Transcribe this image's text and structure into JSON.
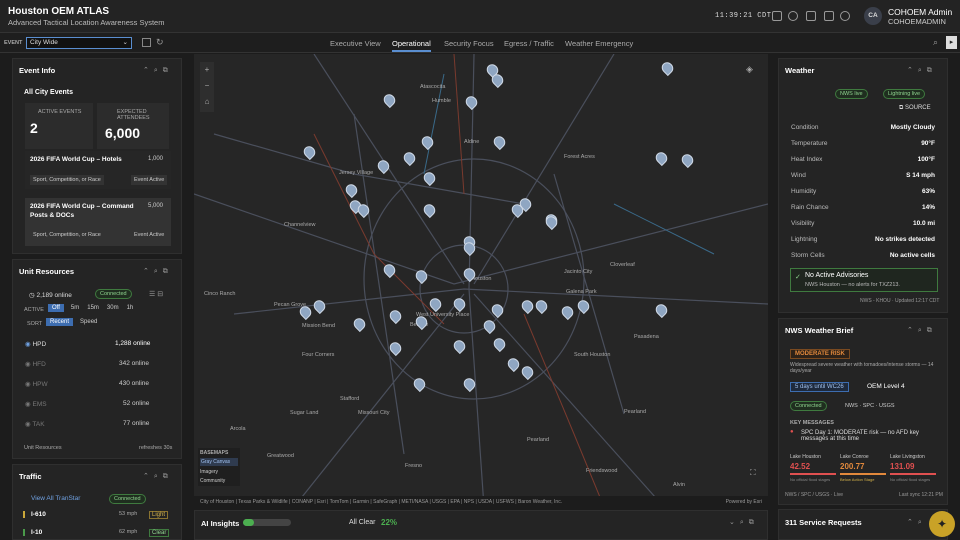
{
  "app": {
    "title": "Houston OEM ATLAS",
    "subtitle": "Advanced Tactical Location Awareness System",
    "clock": "11:39:21 CDT",
    "user_initials": "CA",
    "user_name": "COHOEM Admin",
    "user_id": "COHOEMADMIN"
  },
  "event": {
    "label": "EVENT",
    "selected": "City Wide"
  },
  "tabs": [
    "Executive View",
    "Operational",
    "Security Focus",
    "Egress / Traffic",
    "Weather Emergency"
  ],
  "event_info": {
    "title": "Event Info",
    "all_label": "All City Events",
    "active_label": "ACTIVE EVENTS",
    "active_value": "2",
    "expected_label": "EXPECTED ATTENDEES",
    "expected_value": "6,000",
    "events": [
      {
        "name": "2026 FIFA World Cup – Hotels",
        "count": "1,000",
        "tag1": "Sport, Competition, or Race",
        "tag2": "Event Active"
      },
      {
        "name": "2026 FIFA World Cup – Command Posts & DOCs",
        "count": "5,000",
        "tag1": "Sport, Competition, or Race",
        "tag2": "Event Active"
      }
    ]
  },
  "units": {
    "title": "Unit Resources",
    "online": "2,189 online",
    "connected": "Connected",
    "active_label": "ACTIVE",
    "windows": [
      "Off",
      "5m",
      "15m",
      "30m",
      "1h"
    ],
    "sort_label": "SORT",
    "sorts": [
      "Recent",
      "Speed"
    ],
    "rows": [
      {
        "name": "HPD",
        "value": "1,288 online"
      },
      {
        "name": "HFD",
        "value": "342 online"
      },
      {
        "name": "HPW",
        "value": "430 online"
      },
      {
        "name": "EMS",
        "value": "52 online"
      },
      {
        "name": "TAK",
        "value": "77 online"
      }
    ],
    "footer_left": "Unit Resources",
    "footer_right": "refreshes 30s"
  },
  "traffic": {
    "title": "Traffic",
    "link": "View All TranStar",
    "connected": "Connected",
    "rows": [
      {
        "name": "I-610",
        "speed": "53 mph",
        "status": "Light"
      },
      {
        "name": "I-10",
        "speed": "62 mph",
        "status": "Clear"
      }
    ]
  },
  "map": {
    "labels": [
      "Atascocita",
      "Humble",
      "Jersey Village",
      "Aldine",
      "Forest Acres",
      "Cloverleaf",
      "Jacinto City",
      "Galena Park",
      "Pasadena",
      "South Houston",
      "Houston",
      "West University Place",
      "Bellaire",
      "Mission Bend",
      "Four Corners",
      "Cinco Ranch",
      "Sugar Land",
      "Stafford",
      "Missouri City",
      "Pearland",
      "Friendswood",
      "Fresno",
      "Greatwood",
      "Arcola",
      "Alvin",
      "Pecan Grove",
      "Pearland",
      "Channelview"
    ],
    "basemaps_title": "BASEMAPS",
    "basemaps": [
      "Gray Canvas",
      "Imagery",
      "Community"
    ],
    "attribution": "City of Houston | Texas Parks & Wildlife | CONANP | Esri | TomTom | Garmin | SafeGraph | METI/NASA | USGS | EPA | NPS | USDA | USFWS | Baron Weather, Inc.",
    "powered": "Powered by Esri"
  },
  "ai": {
    "title": "AI Insights",
    "status": "All Clear",
    "percent": "22%"
  },
  "weather": {
    "title": "Weather",
    "nws": "NWS live",
    "lightning": "Lightning live",
    "source": "SOURCE",
    "rows": [
      {
        "k": "Condition",
        "v": "Mostly Cloudy"
      },
      {
        "k": "Temperature",
        "v": "90°F"
      },
      {
        "k": "Heat Index",
        "v": "100°F"
      },
      {
        "k": "Wind",
        "v": "S 14 mph"
      },
      {
        "k": "Humidity",
        "v": "63%"
      },
      {
        "k": "Rain Chance",
        "v": "14%"
      },
      {
        "k": "Visibility",
        "v": "10.0 mi"
      },
      {
        "k": "Lightning",
        "v": "No strikes detected"
      },
      {
        "k": "Storm Cells",
        "v": "No active cells"
      }
    ],
    "advisory_title": "No Active Advisories",
    "advisory_sub": "NWS Houston — no alerts for TXZ213.",
    "footer": "NWS - KHOU · Updated 12:17 CDT"
  },
  "brief": {
    "title": "NWS Weather Brief",
    "risk": "MODERATE RISK",
    "risk_text": "Widespread severe weather with tornadoes/intense storms — 14 days/year",
    "countdown": "5 days until WC26",
    "oem": "OEM Level 4",
    "connected": "Connected",
    "sources": [
      "NWS",
      "SPC",
      "USGS"
    ],
    "key_title": "KEY MESSAGES",
    "key_text": "SPC Day 1: MODERATE risk — no AFD key messages at this time",
    "lakes": [
      {
        "name": "Lake Houston",
        "value": "42.52",
        "note": "No official flood stages"
      },
      {
        "name": "Lake Conroe",
        "value": "200.77",
        "note": "Below Action Stage"
      },
      {
        "name": "Lake Livingston",
        "value": "131.09",
        "note": "No official flood stages"
      }
    ],
    "footer_left": "NWS / SPC / USGS · Live",
    "footer_right": "Last sync 12:21 PM"
  },
  "service": {
    "title": "311 Service Requests"
  }
}
